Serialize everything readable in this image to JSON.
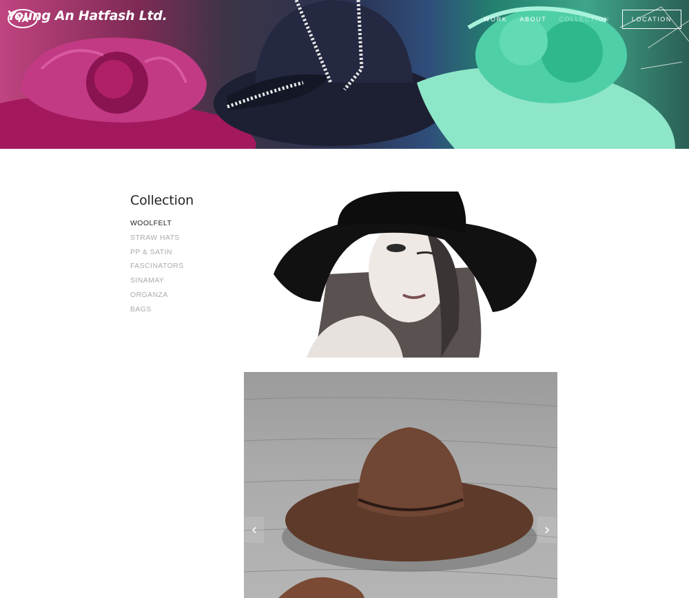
{
  "brand": {
    "name": "Young An Hatfash Ltd.",
    "mark": "YA",
    "logo_icon": "ya-oval-logo"
  },
  "nav": {
    "items": [
      {
        "label": "WORK",
        "state": "normal"
      },
      {
        "label": "ABOUT",
        "state": "normal"
      },
      {
        "label": "COLLECTION",
        "state": "current"
      },
      {
        "label": "LOCATION",
        "state": "boxed"
      }
    ]
  },
  "sidebar": {
    "title": "Collection",
    "items": [
      {
        "label": "WOOLFELT",
        "active": true
      },
      {
        "label": "STRAW HATS",
        "active": false
      },
      {
        "label": "PP & SATIN",
        "active": false
      },
      {
        "label": "FASCINATORS",
        "active": false
      },
      {
        "label": "SINAMAY",
        "active": false
      },
      {
        "label": "ORGANZA",
        "active": false
      },
      {
        "label": "BAGS",
        "active": false
      }
    ]
  },
  "gallery": {
    "prev_icon": "chevron-left-icon",
    "next_icon": "chevron-right-icon",
    "prev_glyph": "‹",
    "next_glyph": "›"
  },
  "colors": {
    "accent_text": "#222222",
    "muted_text": "#aaaaaa",
    "hat_magenta": "#b0206a",
    "hat_navy": "#1e2236",
    "hat_mint": "#5fd4b0",
    "hat_brown": "#6a4030"
  }
}
